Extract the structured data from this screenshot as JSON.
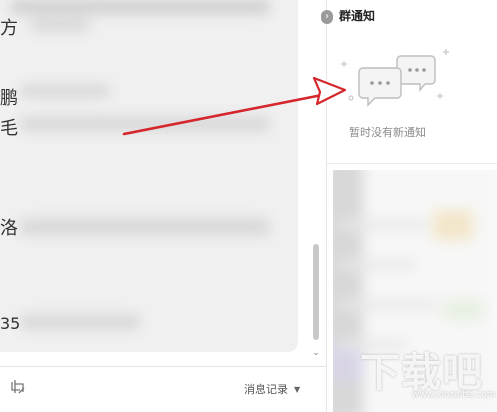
{
  "chat": {
    "visible_chars": [
      "方",
      "鹏",
      "毛",
      "洛",
      "35"
    ],
    "footer": {
      "history_label": "消息记录",
      "history_caret": "▼"
    }
  },
  "group_notice": {
    "collapse_glyph": "›",
    "title": "群通知",
    "empty_text": "暂时没有新通知"
  },
  "watermark": {
    "text": "下载吧",
    "sub": "www.xiazaiba.com"
  },
  "colors": {
    "arrow": "#d4262b",
    "panel_bg": "#ffffff",
    "bubble_bg": "#f0f0f0"
  }
}
